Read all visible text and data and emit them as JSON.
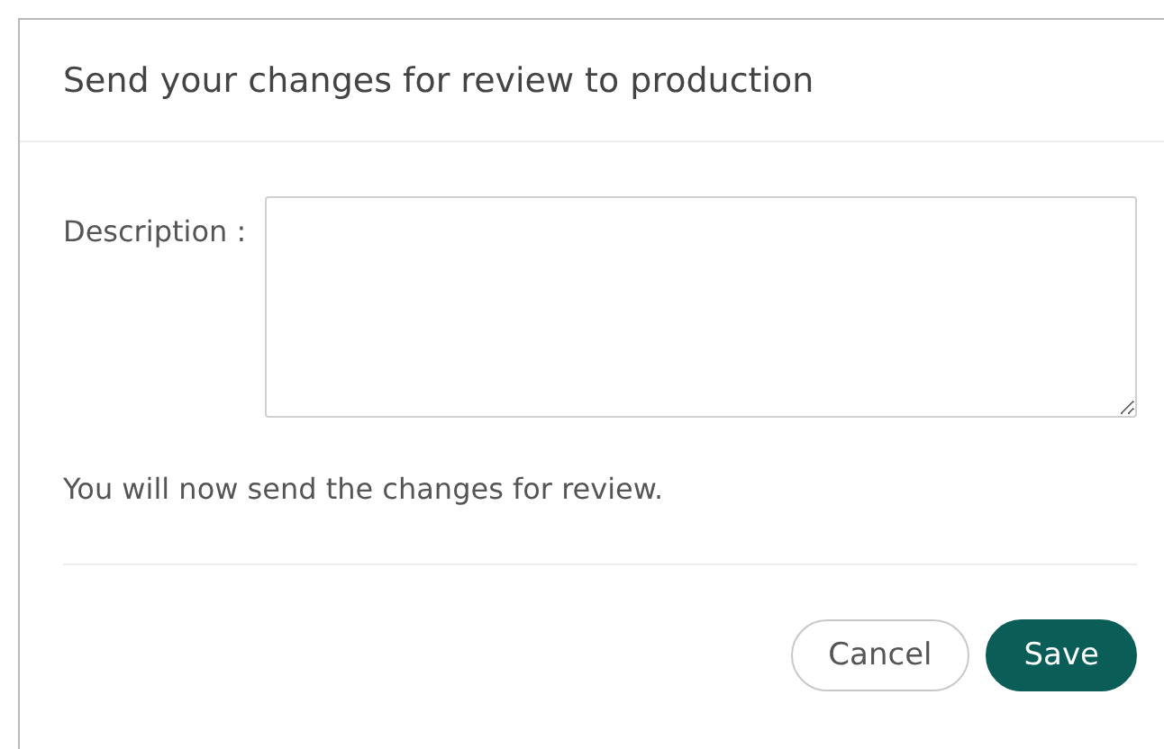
{
  "dialog": {
    "title": "Send your changes for review to production",
    "description_field": {
      "label": "Description :"
    },
    "message": "You will now send the changes for review.",
    "buttons": [
      {
        "label": "Cancel",
        "kind": "secondary"
      },
      {
        "label": "Save",
        "kind": "primary"
      }
    ]
  }
}
